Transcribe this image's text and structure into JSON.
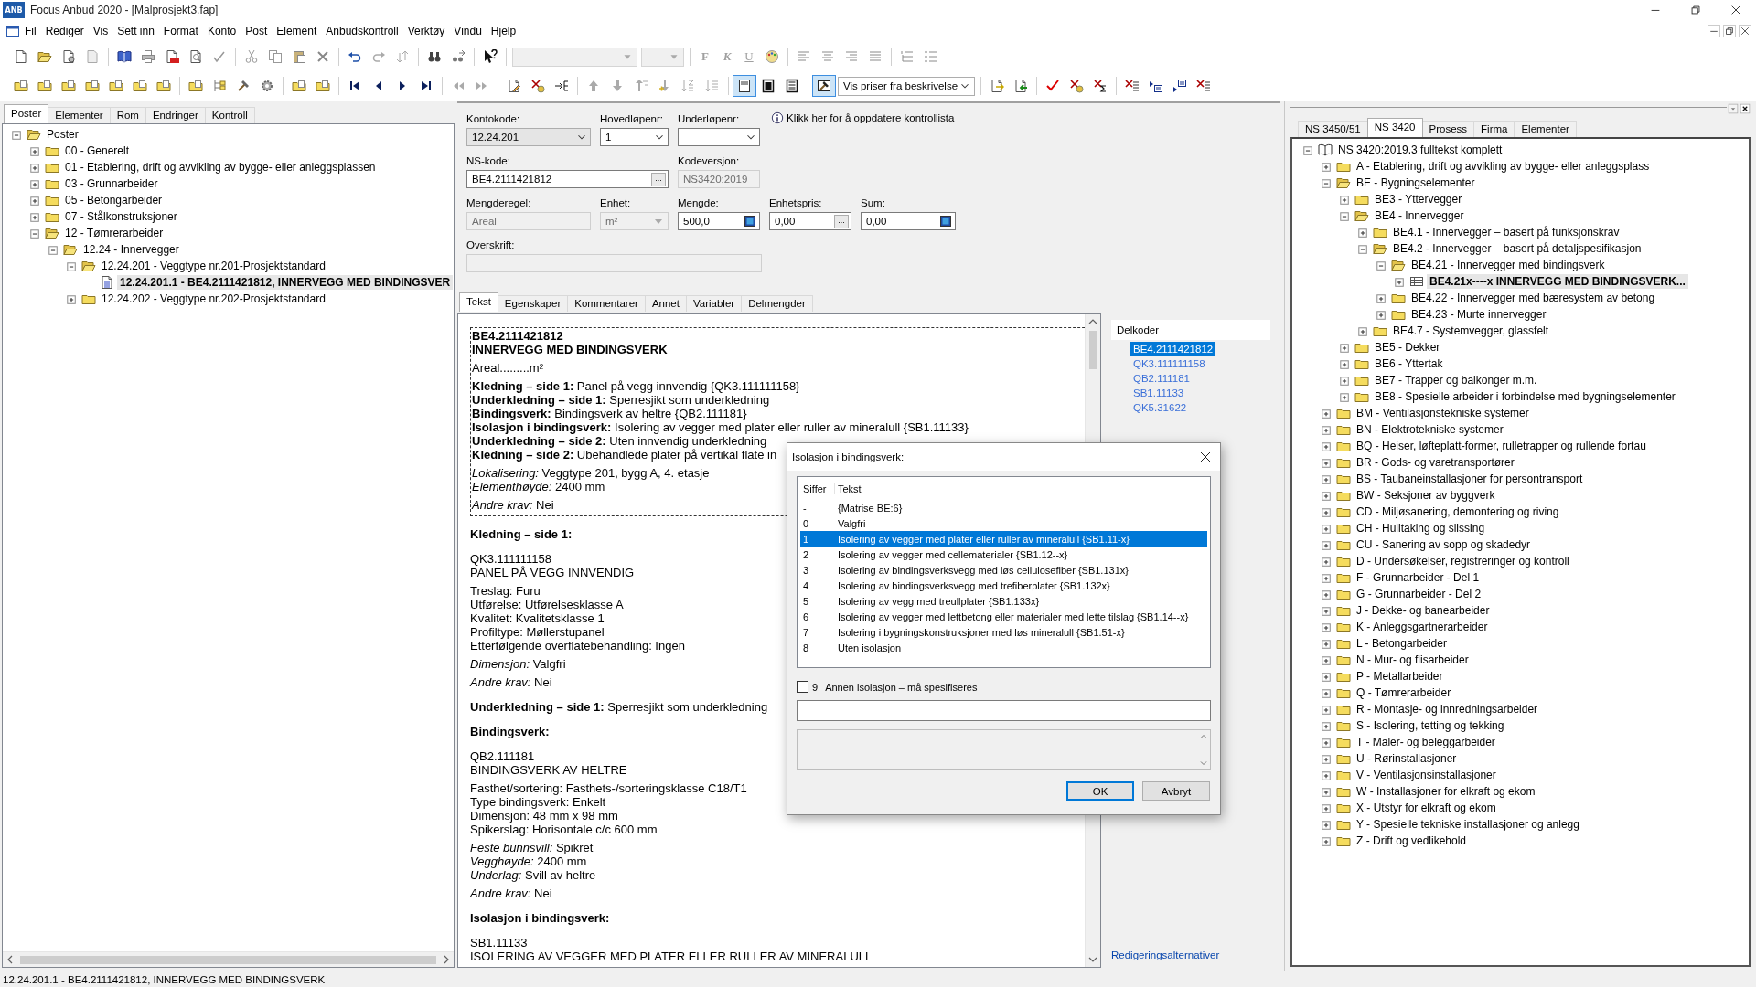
{
  "window": {
    "app_icon": "ANB",
    "title": "Focus Anbud 2020 - [Malprosjekt3.fap]"
  },
  "menu": [
    "Fil",
    "Rediger",
    "Vis",
    "Sett inn",
    "Format",
    "Konto",
    "Post",
    "Element",
    "Anbudskontroll",
    "Verktøy",
    "Vindu",
    "Hjelp"
  ],
  "toolbar": {
    "combos": [
      {
        "disabled": true
      },
      {
        "disabled": true
      },
      {
        "value": "Vis priser fra beskrivelse",
        "disabled": false
      }
    ],
    "format_buttons": [
      {
        "label": "F",
        "disabled": true
      },
      {
        "label": "K",
        "disabled": true
      },
      {
        "label": "U",
        "disabled": true
      }
    ],
    "view_buttons": [
      {
        "selected": true
      },
      {
        "selected": false
      },
      {
        "selected": false
      }
    ],
    "preview_toggle": {
      "on": true
    }
  },
  "left_panel": {
    "tabs": [
      {
        "label": "Poster",
        "selected": true
      },
      {
        "label": "Elementer",
        "selected": false
      },
      {
        "label": "Rom",
        "selected": false
      },
      {
        "label": "Endringer",
        "selected": false
      },
      {
        "label": "Kontroll",
        "selected": false
      }
    ],
    "tree": [
      {
        "label": "Poster",
        "kind": "folder",
        "expanded": true,
        "selected": false,
        "children": [
          {
            "label": "00 - Generelt",
            "kind": "folder",
            "expanded": false,
            "selected": false
          },
          {
            "label": "01 - Etablering, drift og avvikling av bygge- eller anleggsplassen",
            "kind": "folder",
            "expanded": false,
            "selected": false
          },
          {
            "label": "03 - Grunnarbeider",
            "kind": "folder",
            "expanded": false,
            "selected": false
          },
          {
            "label": "05 - Betongarbeider",
            "kind": "folder",
            "expanded": false,
            "selected": false
          },
          {
            "label": "07 - Stålkonstruksjoner",
            "kind": "folder",
            "expanded": false,
            "selected": false
          },
          {
            "label": "12 - Tømrerarbeider",
            "kind": "folder",
            "expanded": true,
            "selected": false,
            "children": [
              {
                "label": "12.24 - Innervegger",
                "kind": "folder",
                "expanded": true,
                "selected": false,
                "children": [
                  {
                    "label": "12.24.201 - Veggtype nr.201-Prosjektstandard",
                    "kind": "folder",
                    "expanded": true,
                    "selected": false,
                    "children": [
                      {
                        "label": "12.24.201.1 - BE4.2111421812, INNERVEGG MED BINDINGSVER",
                        "kind": "document",
                        "selected": true
                      }
                    ]
                  },
                  {
                    "label": "12.24.202 - Veggtype nr.202-Prosjektstandard",
                    "kind": "folder",
                    "expanded": false,
                    "selected": false
                  }
                ]
              }
            ]
          }
        ]
      }
    ]
  },
  "form": {
    "fields": [
      {
        "label": "Kontokode:",
        "kind": "combo",
        "value": "12.24.201",
        "readonly": true,
        "disabled": false
      },
      {
        "label": "Hovedløpenr:",
        "kind": "combo",
        "value": "1",
        "readonly": false,
        "disabled": false
      },
      {
        "label": "Underløpenr:",
        "kind": "combo",
        "readonly": false,
        "disabled": false
      },
      {
        "label": "NS-kode:",
        "kind": "browse",
        "value": "BE4.2111421812",
        "button": "...",
        "readonly": false,
        "disabled": false
      },
      {
        "label": "Kodeversjon:",
        "kind": "text",
        "value": "NS3420:2019",
        "disabled": true
      },
      {
        "label": "Mengderegel:",
        "kind": "text",
        "value": "Areal",
        "disabled": true
      },
      {
        "label": "Enhet:",
        "kind": "combo",
        "value": "m²",
        "disabled": true
      },
      {
        "label": "Mengde:",
        "kind": "calc",
        "value": "500,0",
        "readonly": false,
        "disabled": false
      },
      {
        "label": "Enhetspris:",
        "kind": "browse",
        "value": "0,00",
        "button": "...",
        "readonly": false,
        "disabled": false
      },
      {
        "label": "Sum:",
        "kind": "calc",
        "value": "0,00",
        "readonly": false,
        "disabled": false
      },
      {
        "label": "Overskrift:",
        "kind": "text",
        "disabled": true
      }
    ],
    "info_link": "Klikk her for å oppdatere kontrollista"
  },
  "content_tabs": [
    {
      "label": "Tekst",
      "selected": true
    },
    {
      "label": "Egenskaper",
      "selected": false
    },
    {
      "label": "Kommentarer",
      "selected": false
    },
    {
      "label": "Annet",
      "selected": false
    },
    {
      "label": "Variabler",
      "selected": false
    },
    {
      "label": "Delmengder",
      "selected": false
    }
  ],
  "document": {
    "boxed": [
      {
        "kind": "title",
        "lines": [
          "BE4.2111421812",
          "INNERVEGG MED BINDINGSVERK"
        ]
      },
      {
        "kind": "text",
        "lines": [
          "Areal.........m²"
        ]
      },
      {
        "kind": "text",
        "lines": [
          "**Kledning – side 1:** Panel på vegg innvendig {QK3.111111158}",
          "**Underkledning – side 1:** Sperresjikt som underkledning",
          "**Bindingsverk:** Bindingsverk av heltre {QB2.111181}",
          "**Isolasjon i bindingsverk:** Isolering av vegger med plater eller ruller av mineralull {SB1.11133}",
          "**Underkledning – side 2:** Uten innvendig underkledning",
          "**Kledning – side 2:** Ubehandlede plater på vertikal flate in"
        ]
      },
      {
        "kind": "text",
        "lines": [
          "*Lokalisering:* Veggtype 201, bygg A, 4. etasje",
          "*Elementhøyde:* 2400 mm"
        ]
      },
      {
        "kind": "text",
        "lines": [
          "*Andre krav:* Nei"
        ]
      }
    ],
    "body": [
      {
        "kind": "heading",
        "lines": [
          "Kledning – side 1:"
        ]
      },
      {
        "kind": "text",
        "lines": [
          "QK3.111111158",
          "PANEL PÅ VEGG INNVENDIG"
        ]
      },
      {
        "kind": "text",
        "lines": [
          "Treslag: Furu",
          "Utførelse: Utførelsesklasse A",
          "Kvalitet: Kvalitetsklasse 1",
          "Profiltype: Møllerstupanel",
          "Etterfølgende overflatebehandling: Ingen"
        ]
      },
      {
        "kind": "text",
        "lines": [
          "*Dimensjon:* Valgfri"
        ]
      },
      {
        "kind": "text",
        "lines": [
          "*Andre krav:* Nei"
        ]
      },
      {
        "kind": "lead",
        "lines": [
          "**Underkledning – side 1:** Sperresjikt som underkledning"
        ]
      },
      {
        "kind": "heading",
        "lines": [
          "Bindingsverk:"
        ]
      },
      {
        "kind": "text",
        "lines": [
          "QB2.111181",
          "BINDINGSVERK AV HELTRE"
        ]
      },
      {
        "kind": "text",
        "lines": [
          "Fasthet/sortering: Fasthets-/sorteringsklasse C18/T1",
          "Type bindingsverk: Enkelt",
          "Dimensjon: 48 mm x 98 mm",
          "Spikerslag: Horisontale c/c 600 mm"
        ]
      },
      {
        "kind": "text",
        "lines": [
          "*Feste bunnsvill:* Spikret",
          "*Vegghøyde:* 2400 mm",
          "*Underlag:* Svill av heltre"
        ]
      },
      {
        "kind": "text",
        "lines": [
          "*Andre krav:* Nei"
        ]
      },
      {
        "kind": "heading",
        "lines": [
          "Isolasjon i bindingsverk:"
        ]
      },
      {
        "kind": "text",
        "lines": [
          "SB1.11133",
          "ISOLERING AV VEGGER MED PLATER ELLER RULLER AV MINERALULL"
        ]
      }
    ]
  },
  "delkoder": {
    "title": "Delkoder",
    "items": [
      {
        "code": "BE4.2111421812",
        "selected": true
      },
      {
        "code": "QK3.111111158",
        "selected": false
      },
      {
        "code": "QB2.111181",
        "selected": false
      },
      {
        "code": "SB1.11133",
        "selected": false
      },
      {
        "code": "QK5.31622",
        "selected": false
      }
    ],
    "link": "Redigeringsalternativer"
  },
  "right_panel": {
    "tabs": [
      {
        "label": "NS 3450/51",
        "selected": false
      },
      {
        "label": "NS 3420",
        "selected": true
      },
      {
        "label": "Prosess",
        "selected": false
      },
      {
        "label": "Firma",
        "selected": false
      },
      {
        "label": "Elementer",
        "selected": false
      }
    ],
    "tree": [
      {
        "label": "NS 3420:2019.3 fulltekst komplett",
        "kind": "book",
        "expanded": true,
        "selected": false,
        "children": [
          {
            "label": "A - Etablering, drift og avvikling av bygge- eller anleggsplass",
            "kind": "folder",
            "expanded": false,
            "selected": false
          },
          {
            "label": "BE - Bygningselementer",
            "kind": "folder",
            "expanded": true,
            "selected": false,
            "children": [
              {
                "label": "BE3 - Yttervegger",
                "kind": "folder",
                "expanded": false,
                "selected": false
              },
              {
                "label": "BE4 - Innervegger",
                "kind": "folder",
                "expanded": true,
                "selected": false,
                "children": [
                  {
                    "label": "BE4.1 - Innervegger – basert på funksjonskrav",
                    "kind": "folder",
                    "expanded": false,
                    "selected": false
                  },
                  {
                    "label": "BE4.2 - Innervegger – basert på detaljspesifikasjon",
                    "kind": "folder",
                    "expanded": true,
                    "selected": false,
                    "children": [
                      {
                        "label": "BE4.21 - Innervegger med bindingsverk",
                        "kind": "folder",
                        "expanded": true,
                        "selected": false,
                        "children": [
                          {
                            "label": "BE4.21x----x INNERVEGG MED BINDINGSVERK...",
                            "kind": "table",
                            "expanded": false,
                            "selected": true
                          }
                        ]
                      },
                      {
                        "label": "BE4.22 - Innervegger med bæresystem av betong",
                        "kind": "folder",
                        "expanded": false,
                        "selected": false
                      },
                      {
                        "label": "BE4.23 - Murte innervegger",
                        "kind": "folder",
                        "expanded": false,
                        "selected": false
                      }
                    ]
                  },
                  {
                    "label": "BE4.7 - Systemvegger, glassfelt",
                    "kind": "folder",
                    "expanded": false,
                    "selected": false
                  }
                ]
              },
              {
                "label": "BE5 - Dekker",
                "kind": "folder",
                "expanded": false,
                "selected": false
              },
              {
                "label": "BE6 - Yttertak",
                "kind": "folder",
                "expanded": false,
                "selected": false
              },
              {
                "label": "BE7 - Trapper og balkonger m.m.",
                "kind": "folder",
                "expanded": false,
                "selected": false
              },
              {
                "label": "BE8 - Spesielle arbeider i forbindelse med bygningselementer",
                "kind": "folder",
                "expanded": false,
                "selected": false
              }
            ]
          },
          {
            "label": "BM - Ventilasjonstekniske systemer",
            "kind": "folder",
            "expanded": false,
            "selected": false
          },
          {
            "label": "BN - Elektrotekniske systemer",
            "kind": "folder",
            "expanded": false,
            "selected": false
          },
          {
            "label": "BQ - Heiser, løfteplatt-former, rulletrapper og rullende fortau",
            "kind": "folder",
            "expanded": false,
            "selected": false
          },
          {
            "label": "BR - Gods- og varetransportører",
            "kind": "folder",
            "expanded": false,
            "selected": false
          },
          {
            "label": "BS - Taubaneinstallasjoner for persontransport",
            "kind": "folder",
            "expanded": false,
            "selected": false
          },
          {
            "label": "BW - Seksjoner av byggverk",
            "kind": "folder",
            "expanded": false,
            "selected": false
          },
          {
            "label": "CD - Miljøsanering, demontering og riving",
            "kind": "folder",
            "expanded": false,
            "selected": false
          },
          {
            "label": "CH - Hulltaking og slissing",
            "kind": "folder",
            "expanded": false,
            "selected": false
          },
          {
            "label": "CU - Sanering av sopp og skadedyr",
            "kind": "folder",
            "expanded": false,
            "selected": false
          },
          {
            "label": "D - Undersøkelser, registreringer og kontroll",
            "kind": "folder",
            "expanded": false,
            "selected": false
          },
          {
            "label": "F - Grunnarbeider - Del 1",
            "kind": "folder",
            "expanded": false,
            "selected": false
          },
          {
            "label": "G - Grunnarbeider - Del 2",
            "kind": "folder",
            "expanded": false,
            "selected": false
          },
          {
            "label": "J - Dekke- og banearbeider",
            "kind": "folder",
            "expanded": false,
            "selected": false
          },
          {
            "label": "K - Anleggsgartnerarbeider",
            "kind": "folder",
            "expanded": false,
            "selected": false
          },
          {
            "label": "L - Betongarbeider",
            "kind": "folder",
            "expanded": false,
            "selected": false
          },
          {
            "label": "N - Mur- og flisarbeider",
            "kind": "folder",
            "expanded": false,
            "selected": false
          },
          {
            "label": "P - Metallarbeider",
            "kind": "folder",
            "expanded": false,
            "selected": false
          },
          {
            "label": "Q - Tømrerarbeider",
            "kind": "folder",
            "expanded": false,
            "selected": false
          },
          {
            "label": "R - Montasje- og innredningsarbeider",
            "kind": "folder",
            "expanded": false,
            "selected": false
          },
          {
            "label": "S - Isolering, tetting og tekking",
            "kind": "folder",
            "expanded": false,
            "selected": false
          },
          {
            "label": "T - Maler- og beleggarbeider",
            "kind": "folder",
            "expanded": false,
            "selected": false
          },
          {
            "label": "U - Rørinstallasjoner",
            "kind": "folder",
            "expanded": false,
            "selected": false
          },
          {
            "label": "V - Ventilasjonsinstallasjoner",
            "kind": "folder",
            "expanded": false,
            "selected": false
          },
          {
            "label": "W - Installasjoner for elkraft og ekom",
            "kind": "folder",
            "expanded": false,
            "selected": false
          },
          {
            "label": "X - Utstyr for elkraft og ekom",
            "kind": "folder",
            "expanded": false,
            "selected": false
          },
          {
            "label": "Y - Spesielle tekniske installasjoner og anlegg",
            "kind": "folder",
            "expanded": false,
            "selected": false
          },
          {
            "label": "Z - Drift og vedlikehold",
            "kind": "folder",
            "expanded": false,
            "selected": false
          }
        ]
      }
    ]
  },
  "dialog": {
    "title": "Isolasjon i bindingsverk:",
    "columns": [
      "Siffer",
      "Tekst"
    ],
    "options": [
      {
        "code": "-",
        "text": "{Matrise BE:6}",
        "selected": false
      },
      {
        "code": "0",
        "text": "Valgfri",
        "selected": false
      },
      {
        "code": "1",
        "text": "Isolering av vegger med plater eller ruller av mineralull {SB1.11-x}",
        "selected": true
      },
      {
        "code": "2",
        "text": "Isolering av vegger med cellematerialer {SB1.12--x}",
        "selected": false
      },
      {
        "code": "3",
        "text": "Isolering av bindingsverksvegg med løs cellulosefiber {SB1.131x}",
        "selected": false
      },
      {
        "code": "4",
        "text": "Isolering av bindingsverksvegg med trefiberplater {SB1.132x}",
        "selected": false
      },
      {
        "code": "5",
        "text": "Isolering av vegg med treullplater {SB1.133x}",
        "selected": false
      },
      {
        "code": "6",
        "text": "Isolering av vegger med lettbetong eller materialer med lette tilslag {SB1.14--x}",
        "selected": false
      },
      {
        "code": "7",
        "text": "Isolering i bygningskonstruksjoner med løs mineralull {SB1.51-x}",
        "selected": false
      },
      {
        "code": "8",
        "text": "Uten isolasjon",
        "selected": false
      }
    ],
    "other": {
      "code": "9",
      "label": "Annen isolasjon – må spesifiseres",
      "checked": false
    },
    "buttons": [
      {
        "label": "OK",
        "default": true
      },
      {
        "label": "Avbryt",
        "default": false
      }
    ]
  },
  "status_bar": "12.24.201.1 - BE4.2111421812, INNERVEGG MED BINDINGSVERK"
}
